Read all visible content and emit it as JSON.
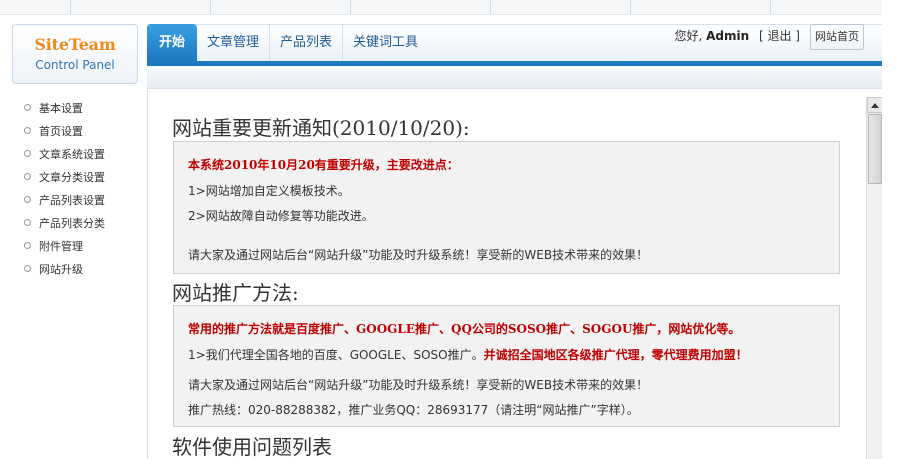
{
  "logo": {
    "brand": "SiteTeam",
    "subtitle": "Control Panel"
  },
  "tabs": [
    {
      "label": "开始",
      "active": true
    },
    {
      "label": "文章管理",
      "active": false
    },
    {
      "label": "产品列表",
      "active": false
    },
    {
      "label": "关键词工具",
      "active": false
    }
  ],
  "user": {
    "greeting": "您好,",
    "name": "Admin",
    "logout": "[ 退出 ]",
    "home_button": "网站首页"
  },
  "sidebar": {
    "items": [
      {
        "label": "基本设置"
      },
      {
        "label": "首页设置"
      },
      {
        "label": "文章系统设置"
      },
      {
        "label": "文章分类设置"
      },
      {
        "label": "产品列表设置"
      },
      {
        "label": "产品列表分类"
      },
      {
        "label": "附件管理"
      },
      {
        "label": "网站升级"
      }
    ]
  },
  "content": {
    "section1_title": "网站重要更新通知(2010/10/20):",
    "section1": {
      "headline": "本系统2010年10月20有重要升级，主要改进点：",
      "line1": "1>网站增加自定义模板技术。",
      "line2": "2>网站故障自动修复等功能改进。",
      "line3": "请大家及通过网站后台“网站升级”功能及时升级系统！享受新的WEB技术带来的效果！"
    },
    "section2_title": "网站推广方法:",
    "section2": {
      "headline": "常用的推广方法就是百度推广、GOOGLE推广、QQ公司的SOSO推广、SOGOU推广，网站优化等。",
      "line1_plain": "1>我们代理全国各地的百度、GOOGLE、SOSO推广。",
      "line1_red": "并诚招全国地区各级推广代理，零代理费用加盟！",
      "line2": "请大家及通过网站后台“网站升级”功能及时升级系统！享受新的WEB技术带来的效果！",
      "line3": "推广热线：020-88288382，推广业务QQ：28693177（请注明“网站推广”字样）。"
    },
    "section3_title": "软件使用问题列表"
  },
  "colors": {
    "accent_blue": "#1c7bbf",
    "logo_orange": "#f08a1a",
    "highlight_red": "#c00000"
  }
}
